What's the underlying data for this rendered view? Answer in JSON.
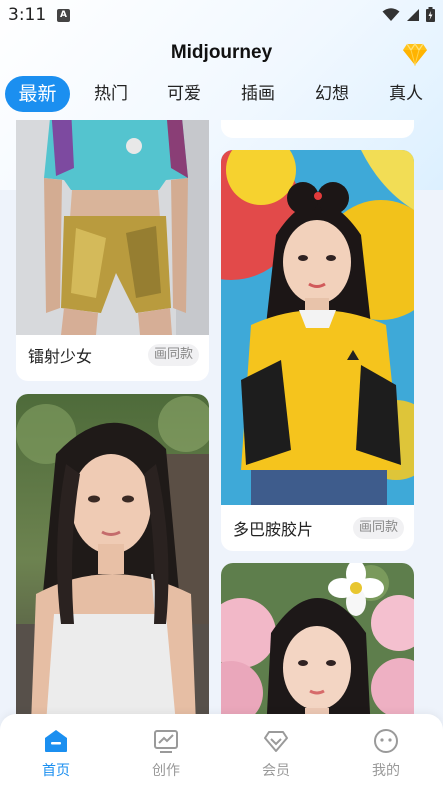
{
  "status_bar": {
    "time": "3:11",
    "notification_letter": "A"
  },
  "header": {
    "title": "Midjourney"
  },
  "tabs": [
    {
      "label": "最新",
      "active": true
    },
    {
      "label": "热门",
      "active": false
    },
    {
      "label": "可爱",
      "active": false
    },
    {
      "label": "插画",
      "active": false
    },
    {
      "label": "幻想",
      "active": false
    },
    {
      "label": "真人",
      "active": false
    }
  ],
  "cards": [
    {
      "title": "镭射少女",
      "tag": "画同款"
    },
    {
      "title": "多巴胺胶片",
      "tag": "画同款"
    }
  ],
  "bottom_nav": [
    {
      "label": "首页",
      "icon": "home-icon",
      "active": true
    },
    {
      "label": "创作",
      "icon": "create-chart-icon",
      "active": false
    },
    {
      "label": "会员",
      "icon": "vip-diamond-icon",
      "active": false
    },
    {
      "label": "我的",
      "icon": "profile-face-icon",
      "active": false
    }
  ],
  "colors": {
    "accent": "#1b8ff0",
    "page_bg": "#eef3fb",
    "vip_gold": "#ffc21a"
  }
}
